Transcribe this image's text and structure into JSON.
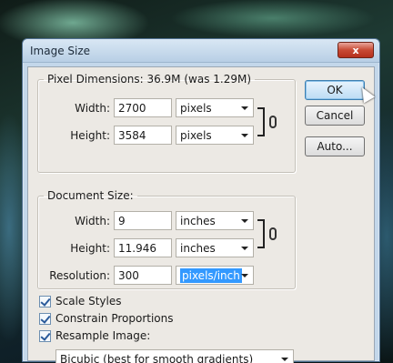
{
  "window": {
    "title": "Image Size",
    "close_label": "x"
  },
  "pixel_dimensions": {
    "legend": "Pixel Dimensions: 36.9M (was 1.29M)",
    "width_label": "Width:",
    "width_value": "2700",
    "width_unit": "pixels",
    "height_label": "Height:",
    "height_value": "3584",
    "height_unit": "pixels"
  },
  "document_size": {
    "legend": "Document Size:",
    "width_label": "Width:",
    "width_value": "9",
    "width_unit": "inches",
    "height_label": "Height:",
    "height_value": "11.946",
    "height_unit": "inches",
    "resolution_label": "Resolution:",
    "resolution_value": "300",
    "resolution_unit": "pixels/inch"
  },
  "buttons": {
    "ok": "OK",
    "cancel": "Cancel",
    "auto": "Auto..."
  },
  "options": {
    "scale_styles": {
      "label": "Scale Styles",
      "checked": true
    },
    "constrain_proportions": {
      "label": "Constrain Proportions",
      "checked": true
    },
    "resample_image": {
      "label": "Resample Image:",
      "checked": true
    },
    "resample_method": "Bicubic (best for smooth gradients)"
  },
  "colors": {
    "title_bar": "#c3d7ea",
    "dialog_bg": "#ece9e4",
    "close_button": "#c84a34",
    "selection": "#3399ff"
  }
}
